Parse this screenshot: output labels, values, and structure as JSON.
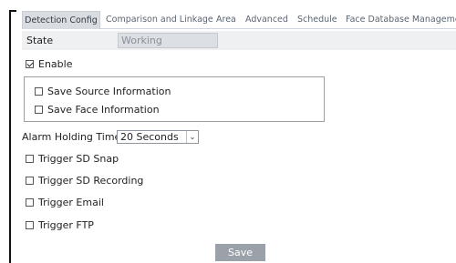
{
  "tabs": [
    {
      "label": "Detection Config",
      "active": true
    },
    {
      "label": "Comparison and Linkage",
      "active": false
    },
    {
      "label": "Area",
      "active": false
    },
    {
      "label": "Advanced",
      "active": false
    },
    {
      "label": "Schedule",
      "active": false
    },
    {
      "label": "Face Database Management",
      "active": false
    }
  ],
  "state": {
    "label": "State",
    "value": "Working"
  },
  "enable": {
    "label": "Enable",
    "checked": true
  },
  "options": [
    {
      "label": "Save Source Information",
      "checked": false
    },
    {
      "label": "Save Face Information",
      "checked": false
    }
  ],
  "alarm_holding": {
    "label": "Alarm Holding Time",
    "value": "20 Seconds"
  },
  "triggers": [
    {
      "label": "Trigger SD Snap",
      "checked": false
    },
    {
      "label": "Trigger SD Recording",
      "checked": false
    },
    {
      "label": "Trigger Email",
      "checked": false
    },
    {
      "label": "Trigger FTP",
      "checked": false
    }
  ],
  "save_label": "Save",
  "colors": {
    "active_tab_bg": "#d9dde2",
    "button_bg": "#9aa1a8",
    "state_row_bg": "#eef0f2"
  }
}
